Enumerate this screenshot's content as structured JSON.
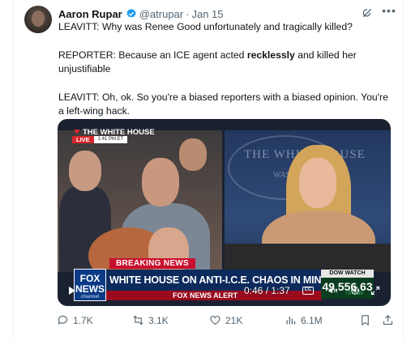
{
  "tweet": {
    "author_name": "Aaron Rupar",
    "handle": "@atrupar",
    "separator": "·",
    "date": "Jan 15",
    "lines": [
      "LEAVITT: Why was Renee Good unfortunately and tragically killed?",
      "REPORTER: Because an ICE agent acted",
      "recklessly",
      "and killed her unjustifiable",
      "LEAVITT: Oh, ok. So you're a biased reporters with a biased opinion. You're a left-wing hack."
    ]
  },
  "video": {
    "wh_label": "THE WHITE HOUSE",
    "live_label": "LIVE",
    "live_time": "1:41 PM ET",
    "seal_text": "THE WHITE HOUSE",
    "seal_sub": "WASHINGTON",
    "breaking": "BREAKING NEWS",
    "headline": "WHITE HOUSE ON ANTI-I.C.E. CHAOS IN MINNEAPOLIS",
    "fox_line1": "FOX",
    "fox_line2": "NEWS",
    "fox_line3": "channel",
    "ticker": "FOX NEWS ALERT",
    "dow_label": "DOW WATCH",
    "dow_value": "49,556.63",
    "dow_change": "+373.50",
    "time": "0:46 / 1:37",
    "cc": "CC"
  },
  "actions": {
    "replies": "1.7K",
    "reposts": "3.1K",
    "likes": "21K",
    "views": "6.1M"
  },
  "colors": {
    "verified": "#1d9bf0",
    "text_secondary": "#536471",
    "breaking_red": "#c8102e",
    "headline_blue": "#0c2a5c"
  },
  "icons": [
    "verified-badge-icon",
    "grok-icon",
    "more-icon",
    "play-icon",
    "cc-icon",
    "volume-icon",
    "gear-icon",
    "fullscreen-icon",
    "reply-icon",
    "repost-icon",
    "like-icon",
    "views-icon",
    "bookmark-icon",
    "share-icon"
  ]
}
